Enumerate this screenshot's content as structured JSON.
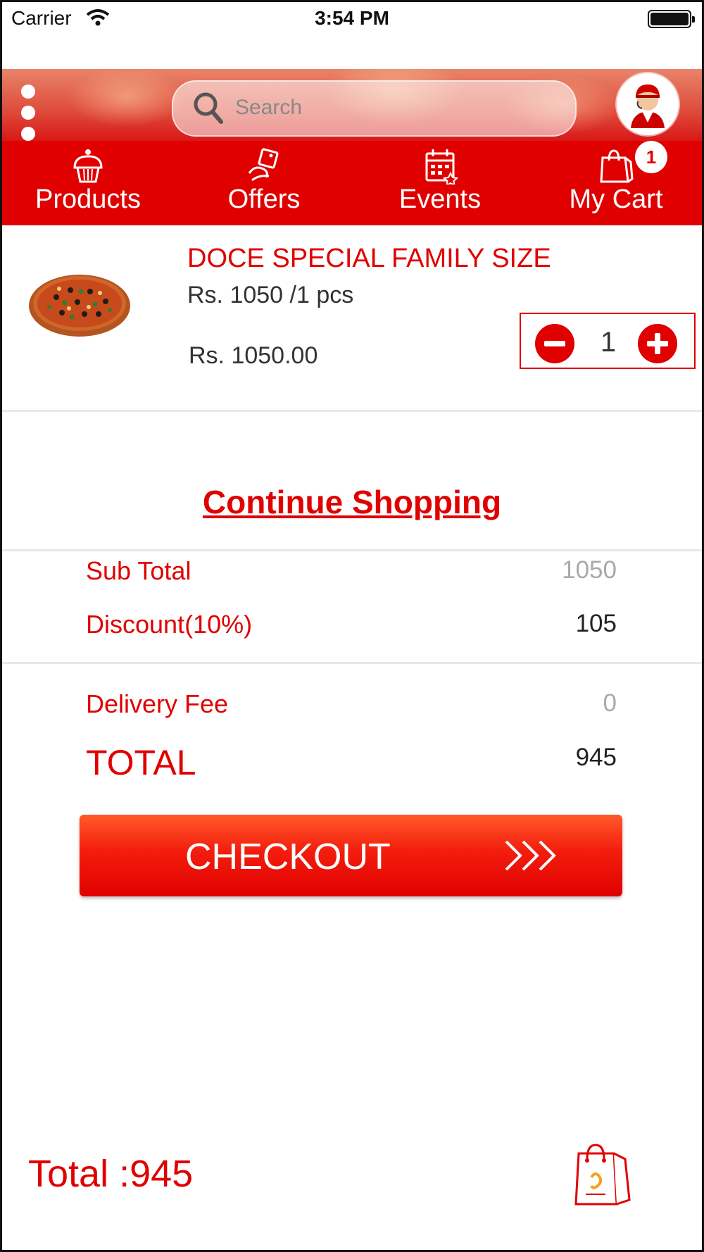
{
  "status_bar": {
    "carrier": "Carrier",
    "time": "3:54 PM"
  },
  "header": {
    "search_placeholder": "Search"
  },
  "nav": {
    "items": [
      {
        "label": "Products",
        "icon": "cupcake-icon"
      },
      {
        "label": "Offers",
        "icon": "offer-tag-icon"
      },
      {
        "label": "Events",
        "icon": "calendar-icon"
      },
      {
        "label": "My Cart",
        "icon": "shopping-bag-icon"
      }
    ],
    "cart_count": "1"
  },
  "cart_item": {
    "name": "DOCE SPECIAL FAMILY SIZE",
    "unit_price": "Rs. 1050 /1 pcs",
    "line_total": "Rs. 1050.00",
    "quantity": "1"
  },
  "continue_label": "Continue Shopping",
  "summary": {
    "subtotal_label": "Sub Total",
    "subtotal_value": "1050",
    "discount_label": "Discount(10%)",
    "discount_value": "105",
    "delivery_label": "Delivery Fee",
    "delivery_value": "0",
    "total_label": "TOTAL",
    "total_value": "945"
  },
  "checkout": {
    "label": "CHECKOUT",
    "arrows": ">>>"
  },
  "footer": {
    "total_text": "Total :945"
  },
  "colors": {
    "accent": "#e00000",
    "muted": "#aaaaaa"
  }
}
